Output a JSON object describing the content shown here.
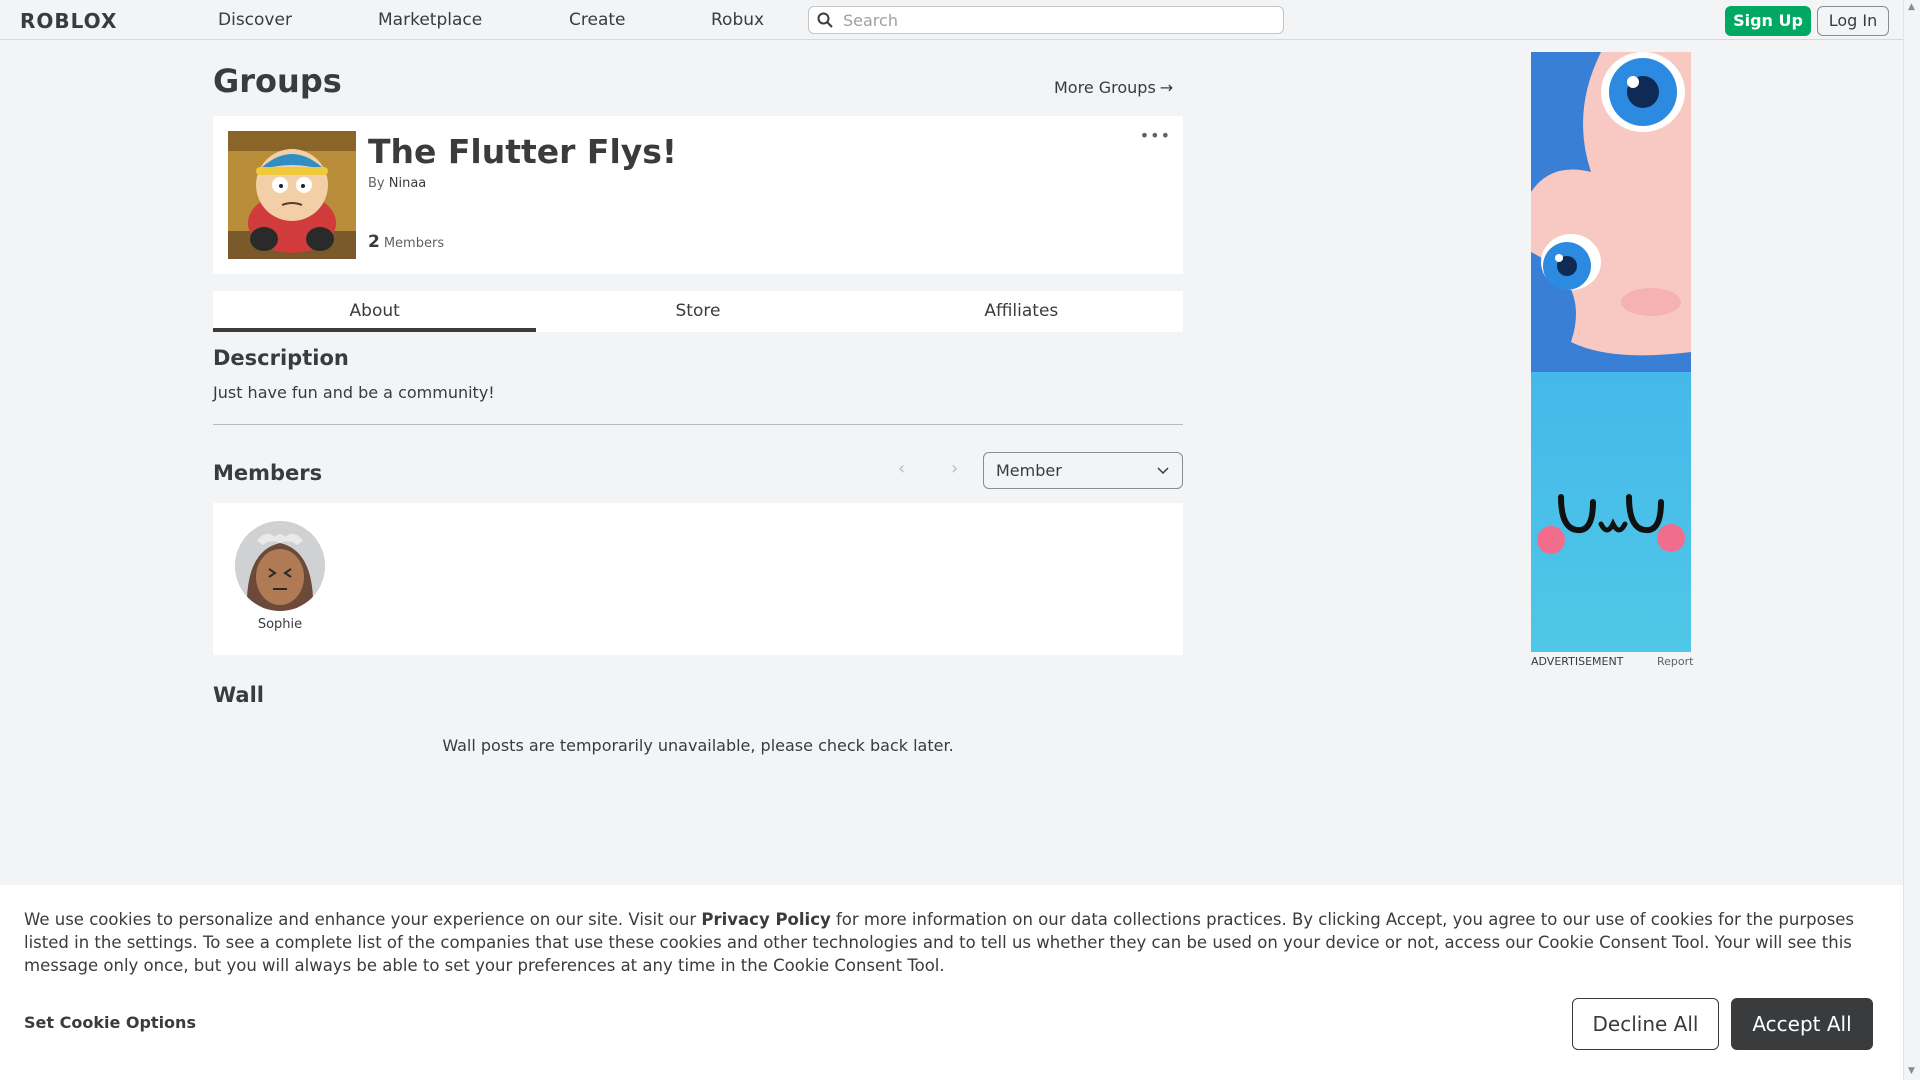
{
  "nav": {
    "logo": "ROBLOX",
    "links": [
      "Discover",
      "Marketplace",
      "Create",
      "Robux"
    ],
    "search_placeholder": "Search",
    "signup_label": "Sign Up",
    "login_label": "Log In"
  },
  "page": {
    "title": "Groups",
    "more_groups": "More Groups"
  },
  "group": {
    "name": "The Flutter Flys!",
    "by_label": "By",
    "owner": "Ninaa",
    "member_count": "2",
    "members_label": "Members",
    "more_menu": "•••"
  },
  "tabs": [
    "About",
    "Store",
    "Affiliates"
  ],
  "about": {
    "description_heading": "Description",
    "description": "Just have fun and be a community!",
    "members_heading": "Members",
    "role_selected": "Member",
    "members": [
      {
        "name": "Sophie"
      }
    ],
    "wall_heading": "Wall",
    "wall_message": "Wall posts are temporarily unavailable, please check back later."
  },
  "ad": {
    "label": "ADVERTISEMENT",
    "report": "Report"
  },
  "cookie": {
    "text_before": "We use cookies to personalize and enhance your experience on our site. Visit our ",
    "privacy_link": "Privacy Policy",
    "text_after": " for more information on our data collections practices. By clicking Accept, you agree to our use of cookies for the purposes listed in the settings. To see a complete list of the companies that use these cookies and other technologies and to tell us whether they can be used on your device or not, access our Cookie Consent Tool. Your will see this message only once, but you will always be able to set your preferences at any time in the Cookie Consent Tool.",
    "set_options": "Set Cookie Options",
    "decline": "Decline All",
    "accept": "Accept All"
  },
  "colors": {
    "accent_green": "#00a862",
    "text_dark": "#393b3d",
    "background": "#f2f4f5"
  }
}
